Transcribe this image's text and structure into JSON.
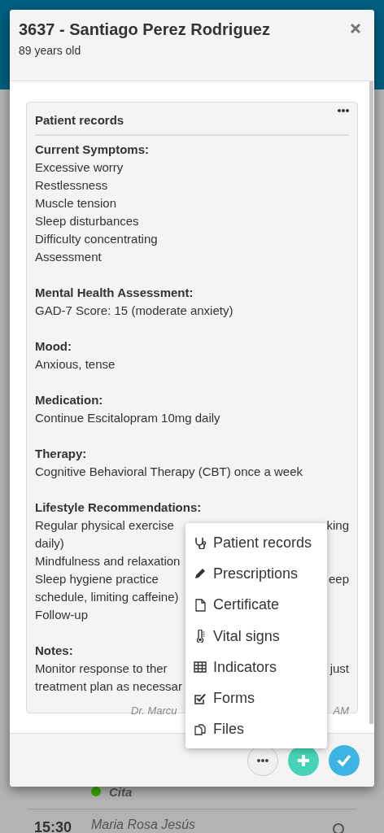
{
  "background": {
    "status": {
      "label": "Cita",
      "color": "#33aa00"
    },
    "time": "15:30",
    "name": "Maria Rosa Jesús"
  },
  "dialog": {
    "title": "3637 - Santiago Perez Rodriguez",
    "subtitle": "89 years old"
  },
  "card": {
    "title": "Patient records",
    "sections": [
      {
        "heading": "Current Symptoms:",
        "lines": [
          {
            "text": "Excessive worry"
          },
          {
            "text": "Restlessness"
          },
          {
            "text": "Muscle tension"
          },
          {
            "text": "Sleep disturbances"
          },
          {
            "text": "Difficulty concentrating"
          },
          {
            "text": "Assessment"
          }
        ]
      },
      {
        "heading": "Mental Health Assessment:",
        "lines": [
          {
            "text": "GAD-7 Score: 15 (moderate anxiety)"
          }
        ]
      },
      {
        "heading": "Mood:",
        "lines": [
          {
            "text": "Anxious, tense"
          }
        ]
      },
      {
        "heading": "Medication:",
        "lines": [
          {
            "text": "Continue Escitalopram 10mg daily"
          }
        ]
      },
      {
        "heading": "Therapy:",
        "lines": [
          {
            "text": "Cognitive Behavioral Therapy (CBT) once a week"
          }
        ]
      },
      {
        "heading": "Lifestyle Recommendations:",
        "lines": [
          {
            "left": "Regular physical exercise",
            "right": "king"
          },
          {
            "text": "daily)"
          },
          {
            "text": "Mindfulness and relaxation"
          },
          {
            "left": "Sleep hygiene practice",
            "right": "eep"
          },
          {
            "text": "schedule, limiting caffeine)"
          },
          {
            "text": "Follow-up"
          }
        ]
      },
      {
        "heading": "Notes:",
        "lines": [
          {
            "left": "Monitor response to ther",
            "right": "just"
          },
          {
            "text": "treatment plan as necessar"
          }
        ]
      }
    ],
    "signature": {
      "left": "Dr. Marcu",
      "right": "AM"
    }
  },
  "menu": [
    {
      "label": "Patient records"
    },
    {
      "label": "Prescriptions"
    },
    {
      "label": "Certificate"
    },
    {
      "label": "Vital signs"
    },
    {
      "label": "Indicators"
    },
    {
      "label": "Forms"
    },
    {
      "label": "Files"
    }
  ]
}
